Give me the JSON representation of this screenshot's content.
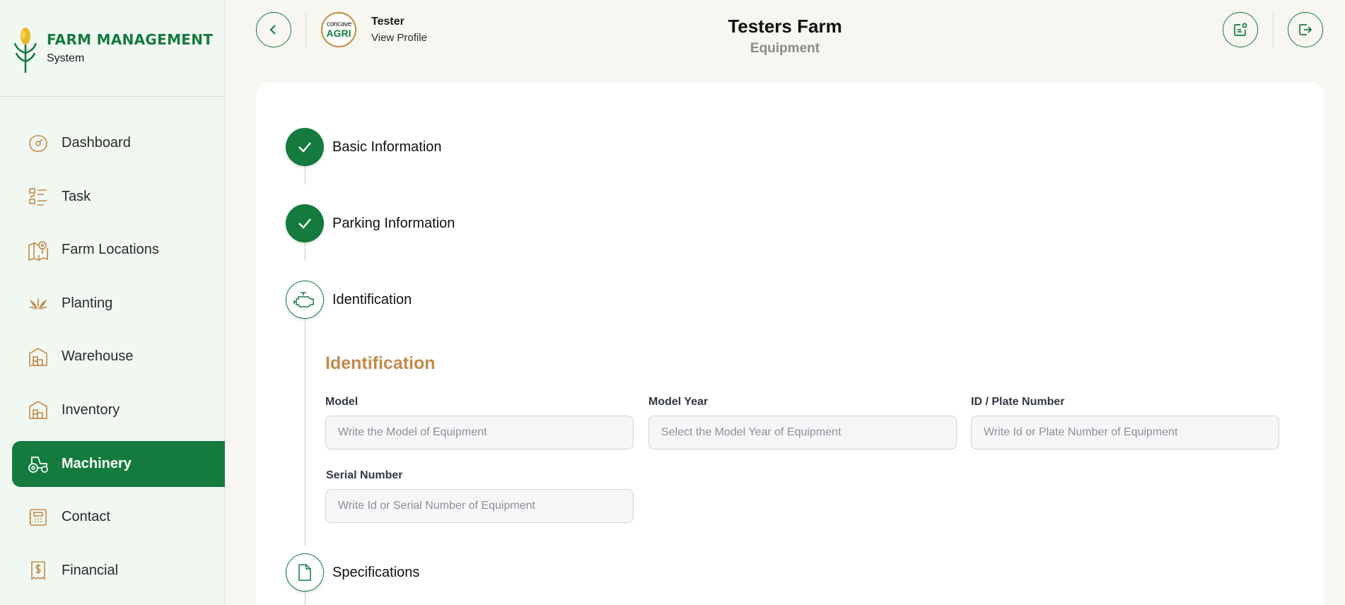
{
  "brand": {
    "title": "FARM MANAGEMENT",
    "subtitle": "System"
  },
  "sidebar": {
    "items": [
      {
        "label": "Dashboard",
        "icon": "dashboard-gauge-icon"
      },
      {
        "label": "Task",
        "icon": "task-list-icon"
      },
      {
        "label": "Farm Locations",
        "icon": "map-pin-icon"
      },
      {
        "label": "Planting",
        "icon": "plant-icon"
      },
      {
        "label": "Warehouse",
        "icon": "warehouse-icon"
      },
      {
        "label": "Inventory",
        "icon": "inventory-icon"
      },
      {
        "label": "Machinery",
        "icon": "tractor-icon",
        "active": true
      },
      {
        "label": "Contact",
        "icon": "contact-icon"
      },
      {
        "label": "Financial",
        "icon": "receipt-dollar-icon"
      }
    ]
  },
  "header": {
    "user_name": "Tester",
    "user_link": "View Profile",
    "avatar_text_top": "concave",
    "avatar_text_bottom": "AGRI",
    "title": "Testers Farm",
    "subtitle": "Equipment"
  },
  "steps": [
    {
      "label": "Basic Information",
      "status": "done",
      "icon": "check-icon"
    },
    {
      "label": "Parking Information",
      "status": "done",
      "icon": "check-icon"
    },
    {
      "label": "Identification",
      "status": "current",
      "icon": "engine-icon"
    },
    {
      "label": "Specifications",
      "status": "pending",
      "icon": "document-icon"
    }
  ],
  "identification": {
    "title": "Identification",
    "fields": {
      "model": {
        "label": "Model",
        "placeholder": "Write the Model of Equipment",
        "value": ""
      },
      "model_year": {
        "label": "Model Year",
        "placeholder": "Select the Model Year of Equipment",
        "value": ""
      },
      "plate": {
        "label": "ID / Plate Number",
        "placeholder": "Write Id or Plate Number of Equipment",
        "value": ""
      },
      "serial": {
        "label": "Serial Number",
        "placeholder": "Write Id or Serial Number of Equipment",
        "value": ""
      }
    }
  },
  "colors": {
    "primary": "#157a3e",
    "accent": "#c28a4a",
    "sidebar_bg": "#f1f8f2",
    "page_bg": "#f7f6f0"
  }
}
